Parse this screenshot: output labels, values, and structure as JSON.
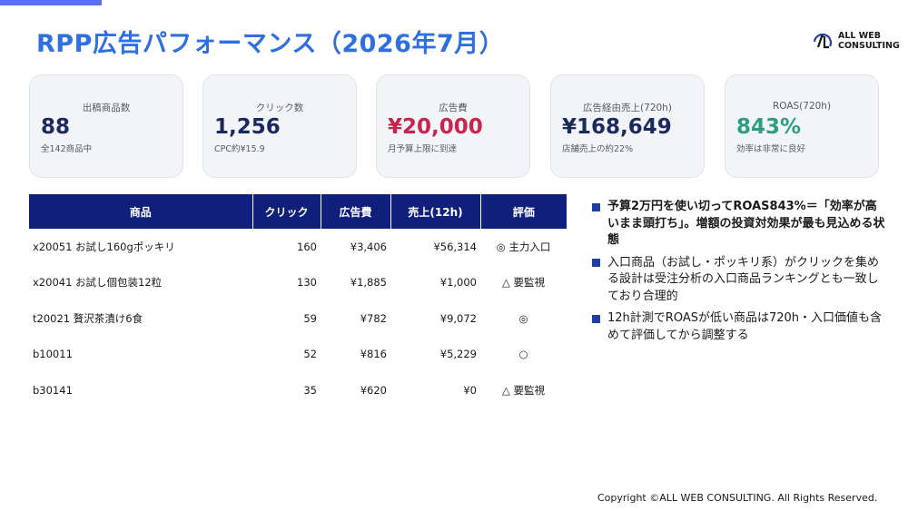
{
  "header": {
    "title": "RPP広告パフォーマンス（2026年7月）",
    "logo_line1": "ALL WEB",
    "logo_line2": "CONSULTING"
  },
  "kpis": [
    {
      "label": "出稿商品数",
      "value": "88",
      "note": "全142商品中"
    },
    {
      "label": "クリック数",
      "value": "1,256",
      "note": "CPC約¥15.9"
    },
    {
      "label": "広告費",
      "value": "¥20,000",
      "note": "月予算上限に到達"
    },
    {
      "label": "広告経由売上(720h)",
      "value": "¥168,649",
      "note": "店舗売上の約22%"
    },
    {
      "label": "ROAS(720h)",
      "value": "843%",
      "note": "効率は非常に良好"
    }
  ],
  "table": {
    "headers": [
      "商品",
      "クリック",
      "広告費",
      "売上(12h)",
      "評価"
    ],
    "rows": [
      {
        "product": "x20051 お試し160gポッキリ",
        "clicks": "160",
        "cost": "¥3,406",
        "sales": "¥56,314",
        "rating": "◎ 主力入口"
      },
      {
        "product": "x20041 お試し個包装12粒",
        "clicks": "130",
        "cost": "¥1,885",
        "sales": "¥1,000",
        "rating": "△ 要監視"
      },
      {
        "product": "t20021 贅沢茶漬け6食",
        "clicks": "59",
        "cost": "¥782",
        "sales": "¥9,072",
        "rating": "◎"
      },
      {
        "product": "b10011",
        "clicks": "52",
        "cost": "¥816",
        "sales": "¥5,229",
        "rating": "○"
      },
      {
        "product": "b30141",
        "clicks": "35",
        "cost": "¥620",
        "sales": "¥0",
        "rating": "△ 要監視"
      }
    ]
  },
  "notes": [
    {
      "text": "予算2万円を使い切ってROAS843%＝「効率が高いまま頭打ち」。増額の投資対効果が最も見込める状態"
    },
    {
      "text": "入口商品（お試し・ポッキリ系）がクリックを集める設計は受注分析の入口商品ランキングとも一致しており合理的"
    },
    {
      "text": "12h計測でROASが低い商品は720h・入口価値も含めて評価してから調整する"
    }
  ],
  "footer": {
    "copyright": "Copyright ©ALL WEB CONSULTING. All Rights Reserved."
  },
  "colors": {
    "title": "#2f6fe0",
    "table_header": "#0f1f7a",
    "accent_red": "#c7244e",
    "accent_teal": "#2e9d83",
    "kpi_value": "#1b2a5c"
  }
}
